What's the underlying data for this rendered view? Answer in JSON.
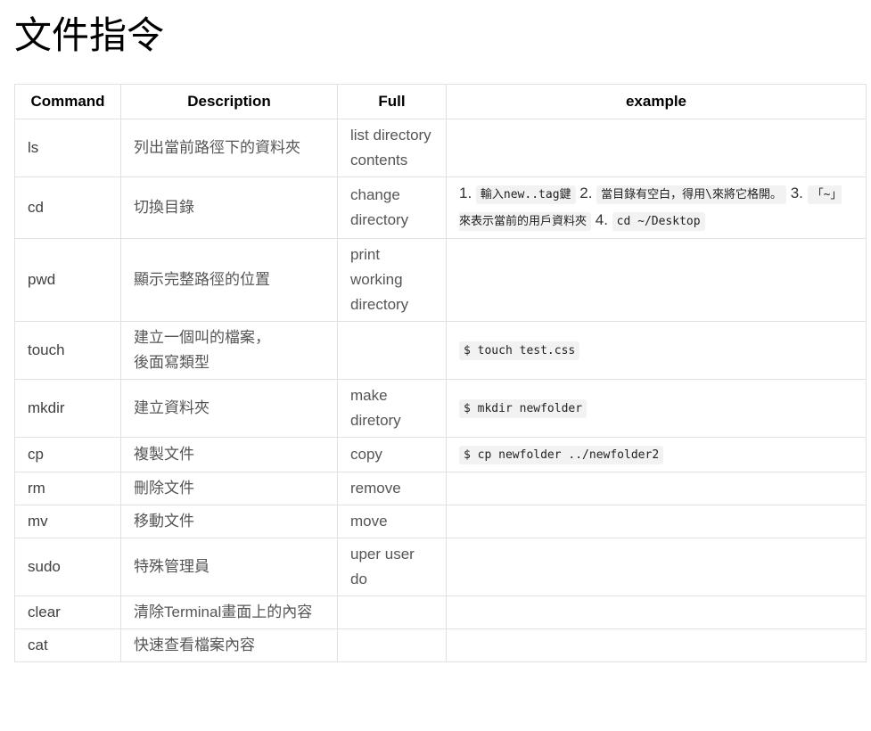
{
  "page": {
    "title": "文件指令"
  },
  "table": {
    "headers": [
      "Command",
      "Description",
      "Full",
      "example"
    ],
    "rows": [
      {
        "command": "ls",
        "description": "列出當前路徑下的資料夾",
        "full": "list directory contents",
        "example": ""
      },
      {
        "command": "cd",
        "description": "切換目錄",
        "full": "change directory",
        "example": "",
        "example_parts": [
          {
            "text": "1. "
          },
          {
            "code": "輸入new..tag鍵"
          },
          {
            "text": " 2. "
          },
          {
            "code": "當目錄有空白，得用\\來將它格開。"
          },
          {
            "text": " 3. "
          },
          {
            "code": "「~」來表示當前的用戶資料夾"
          },
          {
            "text": " 4. "
          },
          {
            "code": "cd ~/Desktop"
          }
        ]
      },
      {
        "command": "pwd",
        "description": "顯示完整路徑的位置",
        "full": "print working directory",
        "example": ""
      },
      {
        "command": "touch",
        "description": "建立一個叫的檔案，\n後面寫類型",
        "full": "",
        "example": "$ touch test.css"
      },
      {
        "command": "mkdir",
        "description": "建立資料夾",
        "full": "make diretory",
        "example": "$ mkdir newfolder"
      },
      {
        "command": "cp",
        "description": "複製文件",
        "full": "copy",
        "example": "$ cp newfolder ../newfolder2"
      },
      {
        "command": "rm",
        "description": "刪除文件",
        "full": "remove",
        "example": ""
      },
      {
        "command": "mv",
        "description": "移動文件",
        "full": "move",
        "example": ""
      },
      {
        "command": "sudo",
        "description": "特殊管理員",
        "full": "uper user do",
        "example": ""
      },
      {
        "command": "clear",
        "description": "清除Terminal畫面上的內容",
        "full": "",
        "example": ""
      },
      {
        "command": "cat",
        "description": "快速查看檔案內容",
        "full": "",
        "example": ""
      }
    ]
  }
}
